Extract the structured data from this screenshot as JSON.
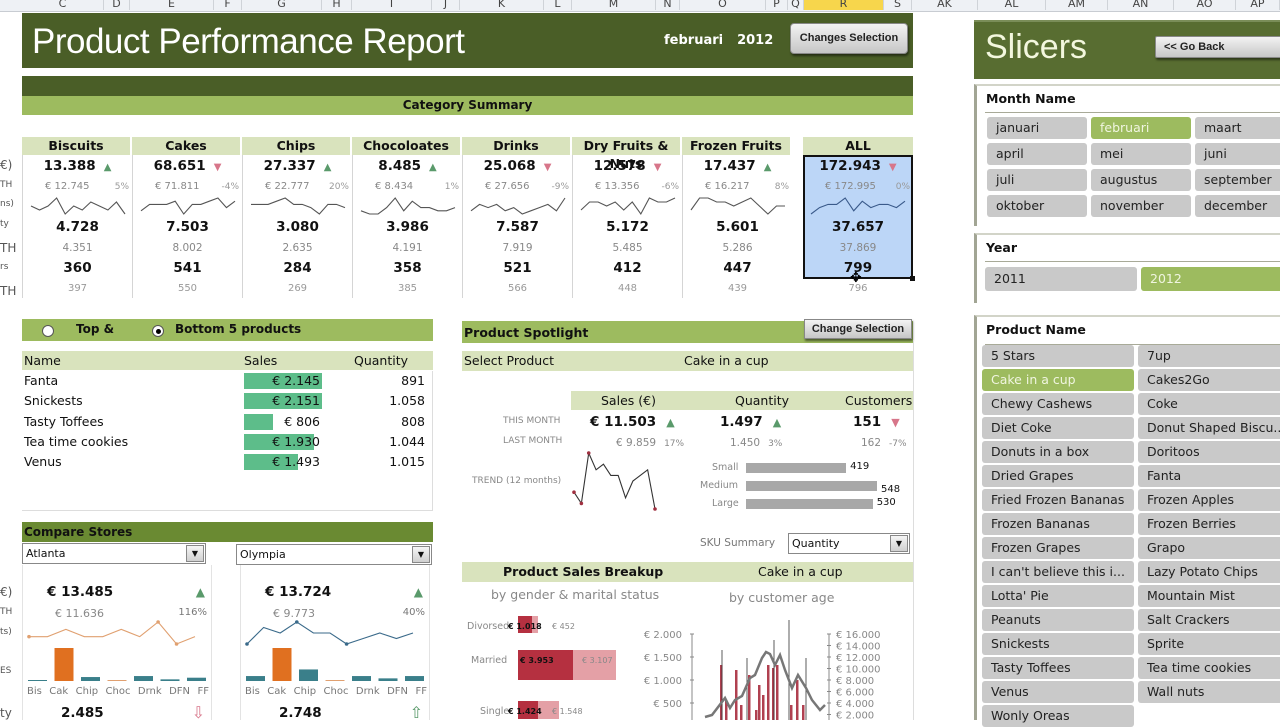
{
  "column_headers": [
    {
      "label": "C"
    },
    {
      "label": "D"
    },
    {
      "label": "E"
    },
    {
      "label": "F"
    },
    {
      "label": "G"
    },
    {
      "label": "H"
    },
    {
      "label": "I"
    },
    {
      "label": "J"
    },
    {
      "label": "K"
    },
    {
      "label": "L"
    },
    {
      "label": "M"
    },
    {
      "label": "N"
    },
    {
      "label": "O"
    },
    {
      "label": "P"
    },
    {
      "label": "Q"
    },
    {
      "label": "R",
      "selected": true
    },
    {
      "label": "S"
    },
    {
      "label": "AK"
    },
    {
      "label": "AL"
    },
    {
      "label": "AM"
    },
    {
      "label": "AN"
    },
    {
      "label": "AO"
    },
    {
      "label": "AP"
    }
  ],
  "header": {
    "title": "Product Performance Report",
    "month": "februari",
    "year": "2012",
    "changes_button": "Changes Selection"
  },
  "category_summary": {
    "title": "Category Summary",
    "row_labels_partial": [
      "€)",
      "TH",
      "ns)",
      "ty",
      "TH",
      "rs",
      "TH"
    ],
    "categories": [
      {
        "name": "Biscuits",
        "sales": "13.388",
        "trend": "up",
        "last_sales": "€ 12.745",
        "pct": "5%",
        "qty": "4.728",
        "last_qty": "4.351",
        "cust": "360",
        "last_cust": "397",
        "spark": [
          5,
          4,
          5,
          7,
          3,
          5,
          4,
          6,
          5,
          4,
          6,
          3
        ]
      },
      {
        "name": "Cakes",
        "sales": "68.651",
        "trend": "down",
        "last_sales": "€ 71.811",
        "pct": "-4%",
        "qty": "7.503",
        "last_qty": "8.002",
        "cust": "541",
        "last_cust": "550",
        "spark": [
          3,
          5,
          5,
          5,
          6,
          2,
          5,
          5,
          6,
          7,
          4,
          6
        ]
      },
      {
        "name": "Chips",
        "sales": "27.337",
        "trend": "up",
        "last_sales": "€ 22.777",
        "pct": "20%",
        "qty": "3.080",
        "last_qty": "2.635",
        "cust": "284",
        "last_cust": "269",
        "spark": [
          5,
          5,
          5,
          6,
          7,
          5,
          5,
          4,
          2,
          5,
          5,
          4
        ]
      },
      {
        "name": "Chocoloates",
        "sales": "8.485",
        "trend": "up",
        "last_sales": "€ 8.434",
        "pct": "1%",
        "qty": "3.986",
        "last_qty": "4.191",
        "cust": "358",
        "last_cust": "385",
        "spark": [
          3,
          2,
          2,
          4,
          7,
          3,
          6,
          4,
          4,
          3,
          3,
          4
        ]
      },
      {
        "name": "Drinks",
        "sales": "25.068",
        "trend": "down",
        "last_sales": "€ 27.656",
        "pct": "-9%",
        "qty": "7.587",
        "last_qty": "7.919",
        "cust": "521",
        "last_cust": "566",
        "spark": [
          3,
          5,
          4,
          5,
          3,
          4,
          2,
          3,
          4,
          5,
          3,
          7
        ]
      },
      {
        "name": "Dry Fruits & Nuts",
        "sales": "12.578",
        "trend": "down",
        "last_sales": "€ 13.356",
        "pct": "-6%",
        "qty": "5.172",
        "last_qty": "5.485",
        "cust": "412",
        "last_cust": "448",
        "spark": [
          3,
          5,
          5,
          4,
          5,
          3,
          5,
          2,
          6,
          5,
          5,
          6
        ]
      },
      {
        "name": "Frozen Fruits",
        "sales": "17.437",
        "trend": "up",
        "last_sales": "€ 16.217",
        "pct": "8%",
        "qty": "5.601",
        "last_qty": "5.286",
        "cust": "447",
        "last_cust": "439",
        "spark": [
          3,
          6,
          6,
          5,
          5,
          4,
          5,
          6,
          4,
          2,
          4,
          4
        ]
      },
      {
        "name": "ALL",
        "sales": "172.943",
        "trend": "down",
        "last_sales": "€ 172.995",
        "pct": "0%",
        "qty": "37.657",
        "last_qty": "37.869",
        "cust": "799",
        "last_cust": "796",
        "spark": [
          2,
          4,
          5,
          5,
          7,
          3,
          6,
          4,
          5,
          5,
          4,
          6
        ]
      }
    ]
  },
  "top_bottom": {
    "option_top": "Top  &",
    "option_bottom": "Bottom 5 products",
    "selected": "bottom",
    "columns": [
      "Name",
      "Sales",
      "Quantity"
    ],
    "rows": [
      {
        "name": "Fanta",
        "sales": "€ 2.145",
        "sales_value": 2145,
        "qty": "891"
      },
      {
        "name": "Snickests",
        "sales": "€ 2.151",
        "sales_value": 2151,
        "qty": "1.058"
      },
      {
        "name": "Tasty Toffees",
        "sales": "€ 806",
        "sales_value": 806,
        "qty": "808"
      },
      {
        "name": "Tea time cookies",
        "sales": "€ 1.930",
        "sales_value": 1930,
        "qty": "1.044"
      },
      {
        "name": "Venus",
        "sales": "€ 1.493",
        "sales_value": 1493,
        "qty": "1.015"
      }
    ]
  },
  "compare_stores": {
    "title": "Compare Stores",
    "category_labels": [
      "Bis",
      "Cak",
      "Chip",
      "Choc",
      "Drnk",
      "DFN",
      "FF"
    ],
    "row_labels_partial": [
      "€)",
      "TH",
      "ts)",
      "ES",
      "ty"
    ],
    "stores": [
      {
        "name": "Atlanta",
        "sales": "€ 13.485",
        "trend": "up",
        "last": "€ 11.636",
        "pct": "116%",
        "qty": "2.485",
        "qty_trend": "down",
        "bars": [
          0.3,
          10,
          1.2,
          0.2,
          1.5,
          0.5,
          1.0
        ],
        "line_color": "#e0a070",
        "spark": [
          4,
          4,
          5,
          4,
          4,
          5,
          4,
          6,
          3,
          4
        ]
      },
      {
        "name": "Olympia",
        "sales": "€ 13.724",
        "trend": "up",
        "last": "€ 9.773",
        "pct": "40%",
        "qty": "2.748",
        "qty_trend": "up",
        "bars": [
          1.5,
          10,
          3.5,
          0.2,
          1.5,
          0.8,
          1.5
        ],
        "line_color": "#3a6a8a",
        "spark": [
          3,
          6,
          5,
          7,
          5,
          5,
          3,
          4,
          5,
          4,
          5
        ]
      }
    ]
  },
  "spotlight": {
    "title": "Product Spotlight",
    "change_button": "Change Selection",
    "select_label": "Select Product",
    "product": "Cake in a cup",
    "metric_headers": [
      "Sales (€)",
      "Quantity",
      "Customers"
    ],
    "this_month_label": "THIS MONTH",
    "last_month_label": "LAST MONTH",
    "trend_label": "TREND (12 months)",
    "this_month": [
      {
        "value": "€ 11.503",
        "trend": "up"
      },
      {
        "value": "1.497",
        "trend": "up"
      },
      {
        "value": "151",
        "trend": "down"
      }
    ],
    "last_month": [
      {
        "value": "€ 9.859",
        "pct": "17%"
      },
      {
        "value": "1.450",
        "pct": "3%"
      },
      {
        "value": "162",
        "pct": "-7%"
      }
    ],
    "trend_values": [
      4,
      2,
      11,
      8,
      9,
      7,
      7,
      3,
      6,
      7,
      8,
      1
    ],
    "sku": [
      {
        "label": "Small",
        "value": 419
      },
      {
        "label": "Medium",
        "value": 548
      },
      {
        "label": "Large",
        "value": 530
      }
    ],
    "sku_summary_label": "SKU Summary",
    "sku_summary_value": "Quantity"
  },
  "breakup": {
    "title": "Product Sales Breakup",
    "product": "Cake in a cup",
    "gender_subtitle": "by gender & marital status",
    "age_subtitle": "by customer age",
    "gender_rows": [
      {
        "label": "Divorsed",
        "dark": "€ 1.018",
        "dark_value": 1018,
        "light": "€ 452",
        "light_value": 452
      },
      {
        "label": "Married",
        "dark": "€ 3.953",
        "dark_value": 3953,
        "light": "€ 3.107",
        "light_value": 3107
      },
      {
        "label": "Single",
        "dark": "€ 1.424",
        "dark_value": 1424,
        "light": "€ 1.548",
        "light_value": 1548
      }
    ],
    "age_left_axis": [
      "€ 2.000",
      "€ 1.500",
      "€ 1.000",
      "€ 500"
    ],
    "age_right_axis": [
      "€ 16.000",
      "€ 14.000",
      "€ 12.000",
      "€ 10.000",
      "€ 8.000",
      "€ 6.000",
      "€ 4.000",
      "€ 2.000"
    ]
  },
  "slicers": {
    "title": "Slicers",
    "go_back": "<< Go Back",
    "month": {
      "title": "Month Name",
      "items": [
        "januari",
        "februari",
        "maart",
        "april",
        "mei",
        "juni",
        "juli",
        "augustus",
        "september",
        "oktober",
        "november",
        "december"
      ],
      "selected": "februari"
    },
    "year": {
      "title": "Year",
      "items": [
        "2011",
        "2012"
      ],
      "selected": "2012"
    },
    "product": {
      "title": "Product Name",
      "items": [
        "5 Stars",
        "7up",
        "Cake in a cup",
        "Cakes2Go",
        "Chewy Cashews",
        "Coke",
        "Diet Coke",
        "Donut Shaped Biscu...",
        "Donuts in a box",
        "Doritoos",
        "Dried Grapes",
        "Fanta",
        "Fried Frozen Bananas",
        "Frozen Apples",
        "Frozen Bananas",
        "Frozen Berries",
        "Frozen Grapes",
        "Grapo",
        "I can't believe this i...",
        "Lazy Potato Chips",
        "Lotta' Pie",
        "Mountain Mist",
        "Peanuts",
        "Salt Crackers",
        "Snickests",
        "Sprite",
        "Tasty Toffees",
        "Tea time cookies",
        "Venus",
        "Wall nuts",
        "Wonly Oreas"
      ],
      "selected": "Cake in a cup"
    }
  },
  "colors": {
    "dark_green": "#4a5e27",
    "light_green": "#9dbb5f",
    "pale_green": "#d9e3bd",
    "up": "#5a9a6b",
    "down": "#d7768a",
    "bar_green": "#5dbd8a",
    "orange": "#e07020",
    "teal": "#3a7f8a"
  }
}
